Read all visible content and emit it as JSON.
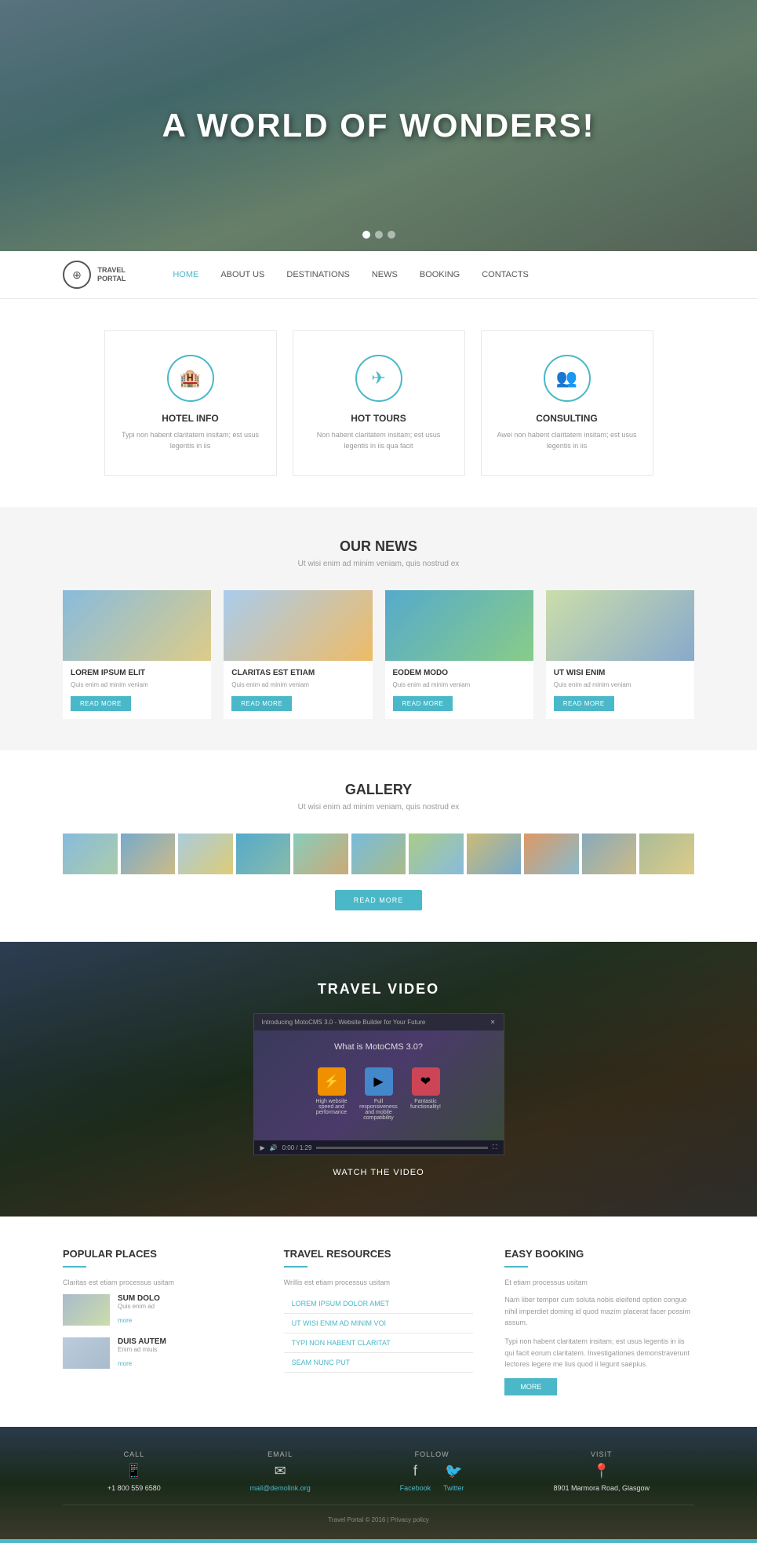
{
  "hero": {
    "title": "A WORLD OF WONDERS!",
    "dots": [
      true,
      false,
      false
    ]
  },
  "navbar": {
    "logo_line1": "TRAVEL",
    "logo_line2": "PORTAL",
    "links": [
      {
        "label": "HOME",
        "active": true
      },
      {
        "label": "ABOUT US",
        "active": false
      },
      {
        "label": "DESTINATIONS",
        "active": false
      },
      {
        "label": "NEWS",
        "active": false
      },
      {
        "label": "BOOKING",
        "active": false
      },
      {
        "label": "CONTACTS",
        "active": false
      }
    ]
  },
  "features": [
    {
      "id": "hotel-info",
      "icon": "🏨",
      "title": "HOTEL INFO",
      "desc": "Typi non habent claritatem insitam; est usus legentis in iis"
    },
    {
      "id": "hot-tours",
      "icon": "✈",
      "title": "HOT TOURS",
      "desc": "Non habent claritatem insitam; est usus legentis in iis qua facit"
    },
    {
      "id": "consulting",
      "icon": "👥",
      "title": "CONSULTING",
      "desc": "Awei non habent claritatem insitam; est usus legentis in iis"
    }
  ],
  "news": {
    "section_title": "OUR NEWS",
    "section_subtitle": "Ut wisi enim ad minim veniam, quis nostrud ex",
    "items": [
      {
        "title": "LOREM IPSUM ELIT",
        "desc": "Quis enim ad minim veniam",
        "btn": "READ MORE"
      },
      {
        "title": "CLARITAS EST ETIAM",
        "desc": "Quis enim ad minim veniam",
        "btn": "READ MORE"
      },
      {
        "title": "EODEM MODO",
        "desc": "Quis enim ad minim veniam",
        "btn": "READ MORE"
      },
      {
        "title": "UT WISI ENIM",
        "desc": "Quis enim ad minim veniam",
        "btn": "READ MORE"
      }
    ]
  },
  "gallery": {
    "section_title": "GALLERY",
    "section_subtitle": "Ut wisi enim ad minim veniam, quis nostrud ex",
    "btn_label": "READ MORE",
    "thumbs": [
      1,
      2,
      3,
      4,
      5,
      6,
      7,
      8,
      9,
      10,
      11
    ]
  },
  "video": {
    "section_title": "TRAVEL VIDEO",
    "player_title": "Introducing MotoCMS 3.0 - Website Builder for Your Future",
    "inner_title": "What is MotoCMS 3.0?",
    "features": [
      {
        "icon": "⚡",
        "color": "icon-orange",
        "text": "High website speed and performance"
      },
      {
        "icon": "▶",
        "color": "icon-blue",
        "text": "Full responsiveness and mobile compatibility"
      },
      {
        "icon": "❤",
        "color": "icon-red",
        "text": "Fantastic functionality!"
      }
    ],
    "duration": "0:00 / 1:29",
    "watch_label": "WATCH THE VIDEO"
  },
  "footer_top": {
    "popular": {
      "title": "POPULAR PLACES",
      "subtitle": "Claritas est etiam processus usitam",
      "items": [
        {
          "name": "SUM DOLO",
          "desc": "Quis enim ad",
          "more": "more"
        },
        {
          "name": "DUIS AUTEM",
          "desc": "Enim ad miuis",
          "more": "more"
        }
      ]
    },
    "resources": {
      "title": "TRAVEL RESOURCES",
      "subtitle": "Wrillis est etiam processus usitam",
      "links": [
        "LOREM IPSUM DOLOR AMET",
        "UT WISI ENIM AD MINIM VOI",
        "TYPI NON HABENT CLARITAT",
        "SEAM NUNC PUT"
      ]
    },
    "booking": {
      "title": "EASY BOOKING",
      "subtitle": "Et etiam processus usitam",
      "text1": "Nam liber tempor cum soluta nobis eleifend option congue nihil imperdiet doming id quod mazim placerat facer possim assum.",
      "text2": "Typi non habent claritatem insitam; est usus legentis in iis qui facit eorum claritatem. Investigationes demonstraverunt lectores legere me lius quod ii legunt saepius.",
      "btn": "MORE"
    }
  },
  "footer_bottom": {
    "contacts": [
      {
        "label": "CALL",
        "icon": "📱",
        "value": "+1 800 559 6580"
      },
      {
        "label": "EMAIL",
        "icon": "✉",
        "value": "mail@demolink.org"
      },
      {
        "label": "FOLLOW",
        "icon": "f",
        "value": "Facebook",
        "icon2": "🐦",
        "value2": "Twitter"
      },
      {
        "label": "VISIT",
        "icon": "📍",
        "value": "8901 Marmora Road, Glasgow"
      }
    ],
    "copyright": "Travel Portal © 2016 | Privacy policy"
  }
}
